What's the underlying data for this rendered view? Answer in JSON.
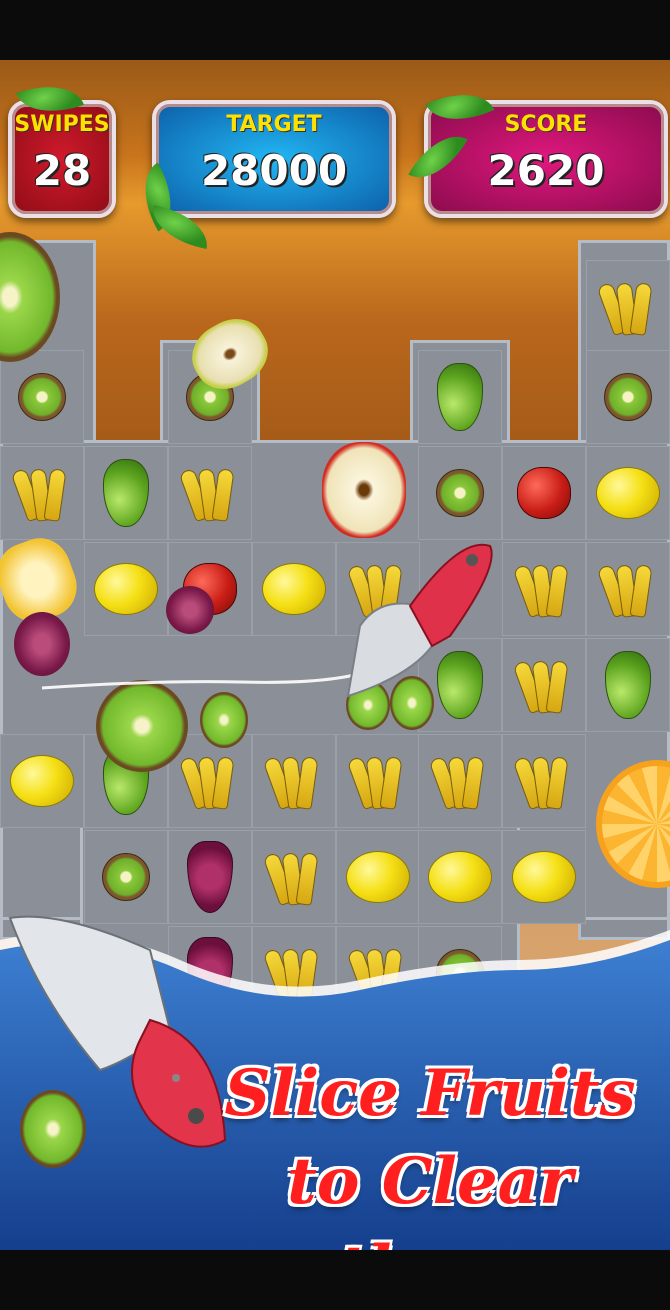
{
  "hud": {
    "swipes": {
      "label": "SWIPES",
      "value": "28"
    },
    "target": {
      "label": "TARGET",
      "value": "28000"
    },
    "score": {
      "label": "SCORE",
      "value": "2620"
    }
  },
  "caption": {
    "line1": "Slice  Fruits",
    "line2": "to  Clear  them"
  },
  "colors": {
    "swipes": "#c0142a",
    "target": "#1d93df",
    "score": "#d0146f",
    "caption": "#ff1f1f",
    "water": "#1e4fa0"
  },
  "board": {
    "fruits": [
      "banana",
      "lemon",
      "pear",
      "kiwi",
      "apple",
      "grape",
      "orange"
    ]
  }
}
